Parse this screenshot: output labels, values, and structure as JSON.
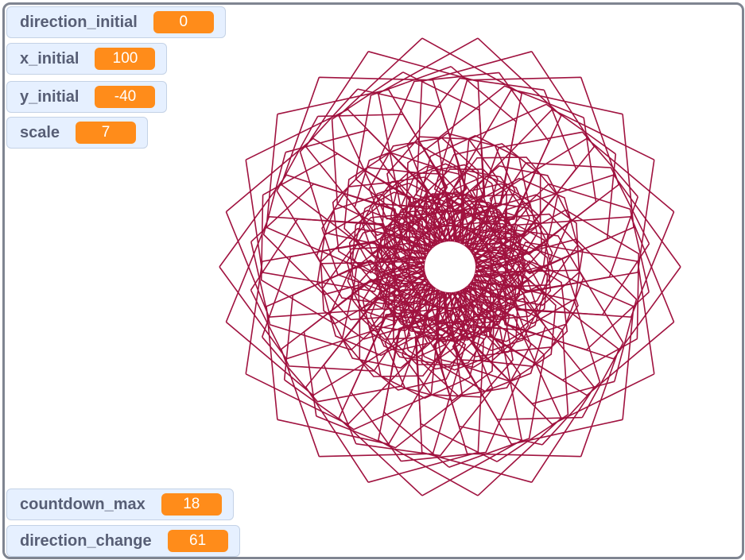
{
  "monitors": {
    "direction_initial": {
      "label": "direction_initial",
      "value": "0"
    },
    "x_initial": {
      "label": "x_initial",
      "value": "100"
    },
    "y_initial": {
      "label": "y_initial",
      "value": "-40"
    },
    "scale": {
      "label": "scale",
      "value": "7"
    },
    "countdown_max": {
      "label": "countdown_max",
      "value": "18"
    },
    "direction_change": {
      "label": "direction_change",
      "value": "61"
    }
  },
  "pen": {
    "color": "#a0123f"
  }
}
